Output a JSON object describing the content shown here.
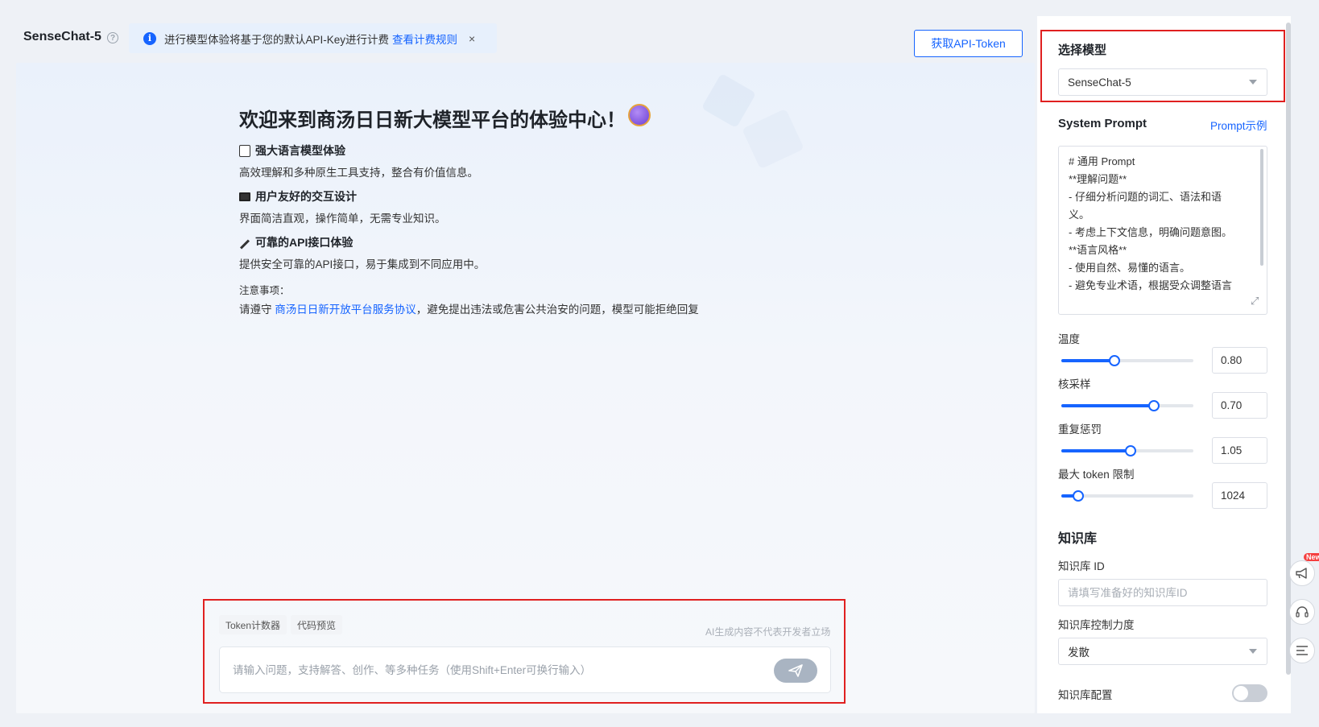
{
  "header": {
    "app_title": "SenseChat-5",
    "help_symbol": "?",
    "notice_text": "进行模型体验将基于您的默认API-Key进行计费",
    "notice_link": "查看计费规则",
    "notice_close": "×",
    "api_token_button": "获取API-Token"
  },
  "welcome": {
    "title": "欢迎来到商汤日日新大模型平台的体验中心！",
    "features": [
      {
        "icon": "document-icon",
        "title": "强大语言模型体验",
        "desc": "高效理解和多种原生工具支持，整合有价值信息。"
      },
      {
        "icon": "monitor-icon",
        "title": "用户友好的交互设计",
        "desc": "界面简洁直观，操作简单，无需专业知识。"
      },
      {
        "icon": "pen-icon",
        "title": "可靠的API接口体验",
        "desc": "提供安全可靠的API接口，易于集成到不同应用中。"
      }
    ],
    "note_label": "注意事项：",
    "note_prefix": "请遵守",
    "note_link": "商汤日日新开放平台服务协议",
    "note_suffix": "，避免提出违法或危害公共治安的问题，模型可能拒绝回复"
  },
  "input_panel": {
    "chip_token": "Token计数器",
    "chip_code": "代码预览",
    "disclaimer": "AI生成内容不代表开发者立场",
    "placeholder": "请输入问题，支持解答、创作、等多种任务（使用Shift+Enter可换行输入）"
  },
  "right_panel": {
    "model_title": "选择模型",
    "model_value": "SenseChat-5",
    "system_prompt_title": "System Prompt",
    "prompt_example_link": "Prompt示例",
    "prompt_lines": [
      "# 通用 Prompt",
      "**理解问题**",
      "- 仔细分析问题的词汇、语法和语",
      "义。",
      "- 考虑上下文信息，明确问题意图。",
      "**语言风格**",
      "- 使用自然、易懂的语言。",
      "- 避免专业术语，根据受众调整语言"
    ],
    "params": [
      {
        "label": "温度",
        "value": "0.80",
        "fraction": 0.4
      },
      {
        "label": "核采样",
        "value": "0.70",
        "fraction": 0.7
      },
      {
        "label": "重复惩罚",
        "value": "1.05",
        "fraction": 0.525
      },
      {
        "label": "最大 token 限制",
        "value": "1024",
        "fraction": 0.125
      }
    ],
    "kb_title": "知识库",
    "kb_id_label": "知识库 ID",
    "kb_id_placeholder": "请填写准备好的知识库ID",
    "kb_control_label": "知识库控制力度",
    "kb_control_value": "发散",
    "kb_config_label": "知识库配置"
  },
  "floating": {
    "new_badge": "New"
  },
  "colors": {
    "accent": "#1664ff",
    "highlight_border": "#e02020"
  }
}
